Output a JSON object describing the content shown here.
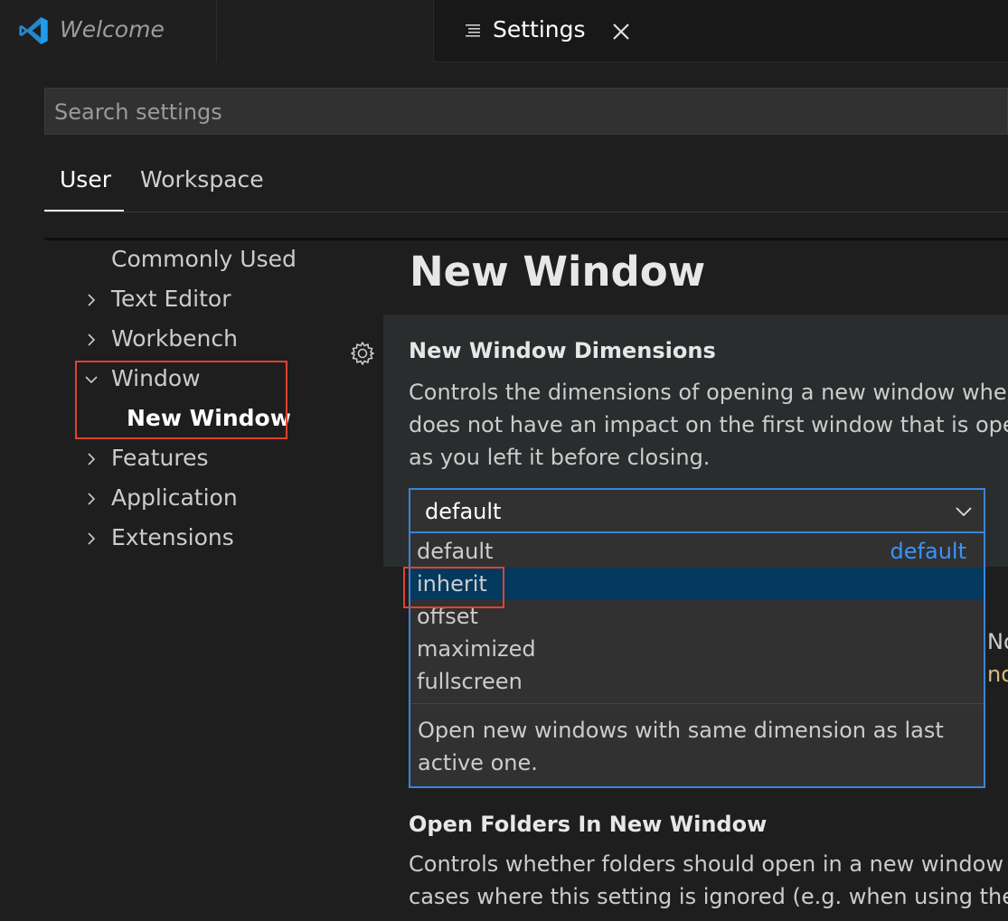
{
  "tabs": {
    "welcome_label": "Welcome",
    "settings_label": "Settings"
  },
  "search": {
    "placeholder": "Search settings",
    "value": ""
  },
  "scope_tabs": {
    "user": "User",
    "workspace": "Workspace",
    "active": "User"
  },
  "toc": {
    "items": [
      {
        "label": "Commonly Used",
        "chevron": "none"
      },
      {
        "label": "Text Editor",
        "chevron": "right"
      },
      {
        "label": "Workbench",
        "chevron": "right"
      },
      {
        "label": "Window",
        "chevron": "down"
      },
      {
        "label": "Features",
        "chevron": "right"
      },
      {
        "label": "Application",
        "chevron": "right"
      },
      {
        "label": "Extensions",
        "chevron": "right"
      }
    ],
    "subitem": "New Window"
  },
  "main": {
    "section_title": "New Window",
    "setting1": {
      "title": "New Window Dimensions",
      "desc_lines": [
        "Controls the dimensions of opening a new window whe",
        "does not have an impact on the first window that is ope",
        "as you left it before closing."
      ],
      "select_value": "default",
      "options": [
        {
          "label": "default",
          "tag": "default"
        },
        {
          "label": "inherit",
          "tag": ""
        },
        {
          "label": "offset",
          "tag": ""
        },
        {
          "label": "maximized",
          "tag": ""
        },
        {
          "label": "fullscreen",
          "tag": ""
        }
      ],
      "highlighted_option": "inherit",
      "option_desc_lines": [
        "Open new windows with same dimension as last",
        "active one."
      ]
    },
    "fragments": [
      "No",
      "nd"
    ],
    "setting2": {
      "title": "Open Folders In New Window",
      "desc_lines": [
        "Controls whether folders should open in a new window",
        "cases where this setting is ignored (e.g. when using the"
      ]
    }
  },
  "colors": {
    "accent": "#3b84d8",
    "highlight_box": "#e0422f",
    "selected_option_bg": "#04395e",
    "default_tag": "#3794ff"
  }
}
